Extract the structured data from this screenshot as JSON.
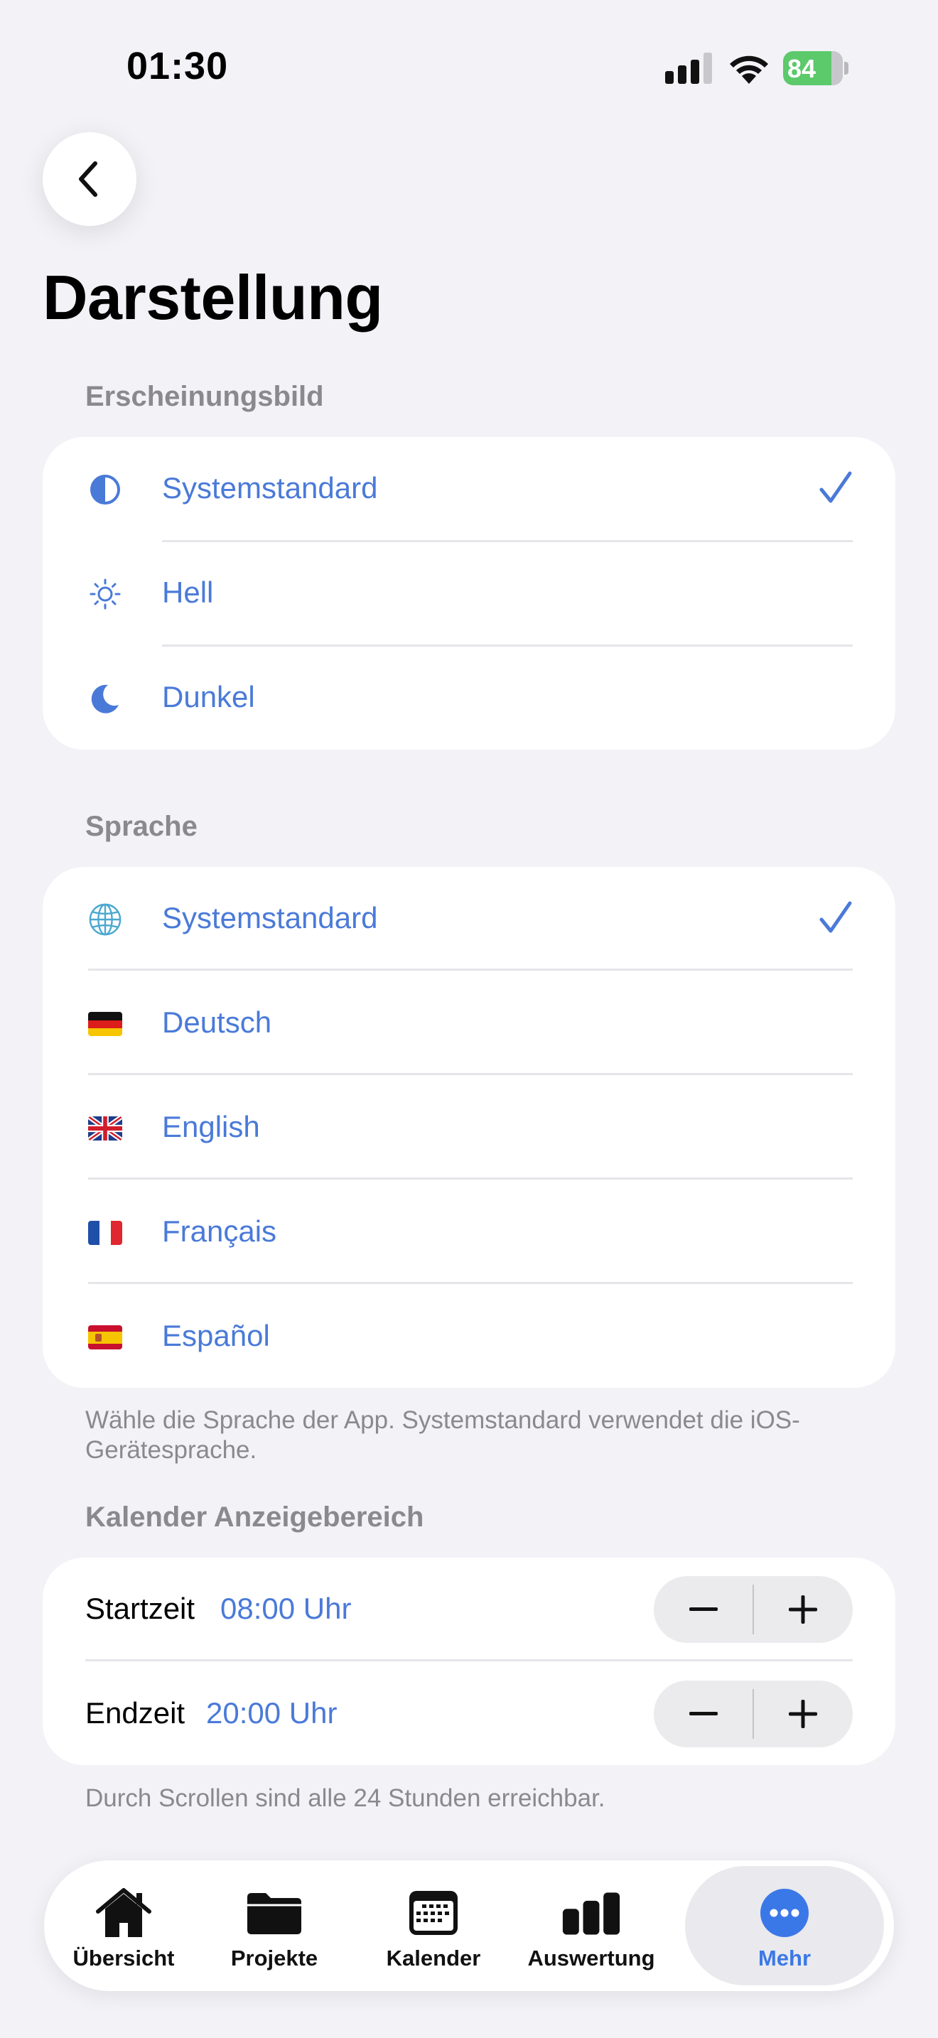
{
  "status_bar": {
    "time": "01:30",
    "battery": "84"
  },
  "page": {
    "title": "Darstellung"
  },
  "appearance": {
    "header": "Erscheinungsbild",
    "items": [
      {
        "label": "Systemstandard",
        "icon": "half-circle-icon",
        "selected": true
      },
      {
        "label": "Hell",
        "icon": "sun-icon",
        "selected": false
      },
      {
        "label": "Dunkel",
        "icon": "moon-icon",
        "selected": false
      }
    ]
  },
  "language": {
    "header": "Sprache",
    "items": [
      {
        "label": "Systemstandard",
        "icon": "globe-icon",
        "selected": true
      },
      {
        "label": "Deutsch",
        "icon": "flag-de-icon",
        "selected": false
      },
      {
        "label": "English",
        "icon": "flag-uk-icon",
        "selected": false
      },
      {
        "label": "Français",
        "icon": "flag-fr-icon",
        "selected": false
      },
      {
        "label": "Español",
        "icon": "flag-es-icon",
        "selected": false
      }
    ],
    "footnote": "Wähle die Sprache der App. Systemstandard verwendet die iOS-Gerätesprache."
  },
  "calendar": {
    "header": "Kalender Anzeigebereich",
    "start": {
      "label": "Startzeit",
      "value": "08:00 Uhr"
    },
    "end": {
      "label": "Endzeit",
      "value": "20:00 Uhr"
    },
    "footnote": "Durch Scrollen sind alle 24 Stunden erreichbar."
  },
  "tabbar": {
    "tabs": [
      {
        "label": "Übersicht",
        "icon": "house-icon"
      },
      {
        "label": "Projekte",
        "icon": "folder-icon"
      },
      {
        "label": "Kalender",
        "icon": "calendar-icon"
      },
      {
        "label": "Auswertung",
        "icon": "bar-chart-icon"
      },
      {
        "label": "Mehr",
        "icon": "ellipsis-circle-icon",
        "active": true
      }
    ]
  },
  "colors": {
    "accent": "#4a7ad8",
    "background": "#f2f2f7",
    "secondary_text": "#8a8a8e"
  }
}
